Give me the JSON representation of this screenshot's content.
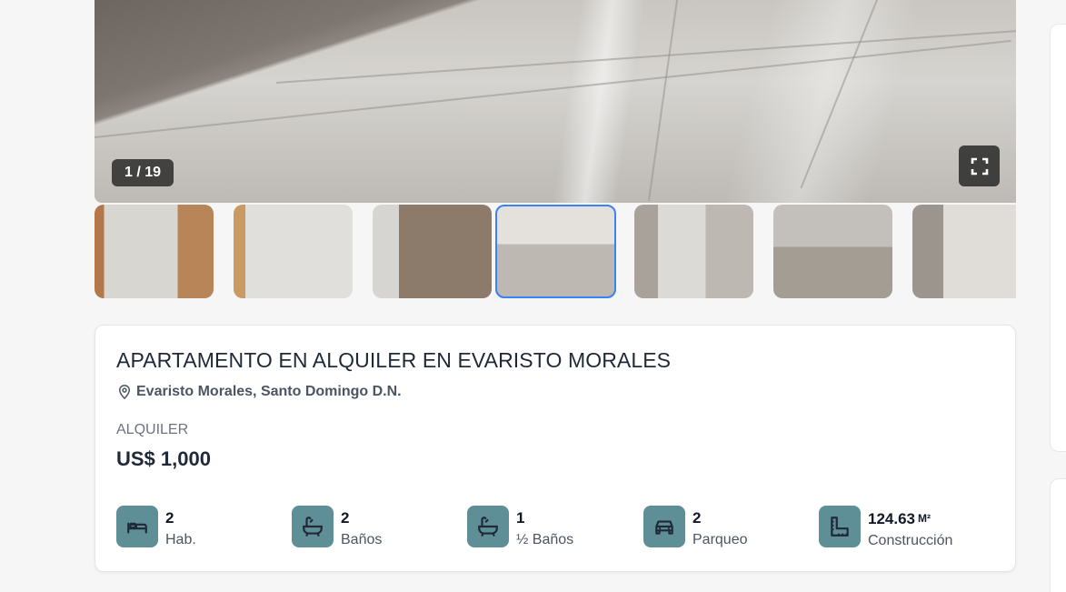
{
  "gallery": {
    "counter": "1 / 19",
    "fullscreen_icon": "fullscreen-icon",
    "thumbnails": [
      "thumb-1",
      "thumb-2",
      "thumb-3",
      "thumb-4",
      "thumb-5",
      "thumb-6",
      "thumb-7"
    ],
    "active_thumbnail": 4
  },
  "listing": {
    "title": "APARTAMENTO EN ALQUILER EN EVARISTO MORALES",
    "location": "Evaristo Morales, Santo Domingo D.N.",
    "location_icon": "map-pin-icon",
    "operation": "ALQUILER",
    "price": "US$ 1,000"
  },
  "features": [
    {
      "icon": "bed-icon",
      "value": "2",
      "unit": "",
      "label": "Hab."
    },
    {
      "icon": "bathtub-icon",
      "value": "2",
      "unit": "",
      "label": "Baños"
    },
    {
      "icon": "bathtub-icon",
      "value": "1",
      "unit": "",
      "label": "½ Baños"
    },
    {
      "icon": "car-icon",
      "value": "2",
      "unit": "",
      "label": "Parqueo"
    },
    {
      "icon": "floor-plan-icon",
      "value": "124.63",
      "unit": "M²",
      "label": "Construcción"
    }
  ],
  "colors": {
    "accent": "#5e8f97",
    "active_thumb_border": "#3b82f6"
  }
}
